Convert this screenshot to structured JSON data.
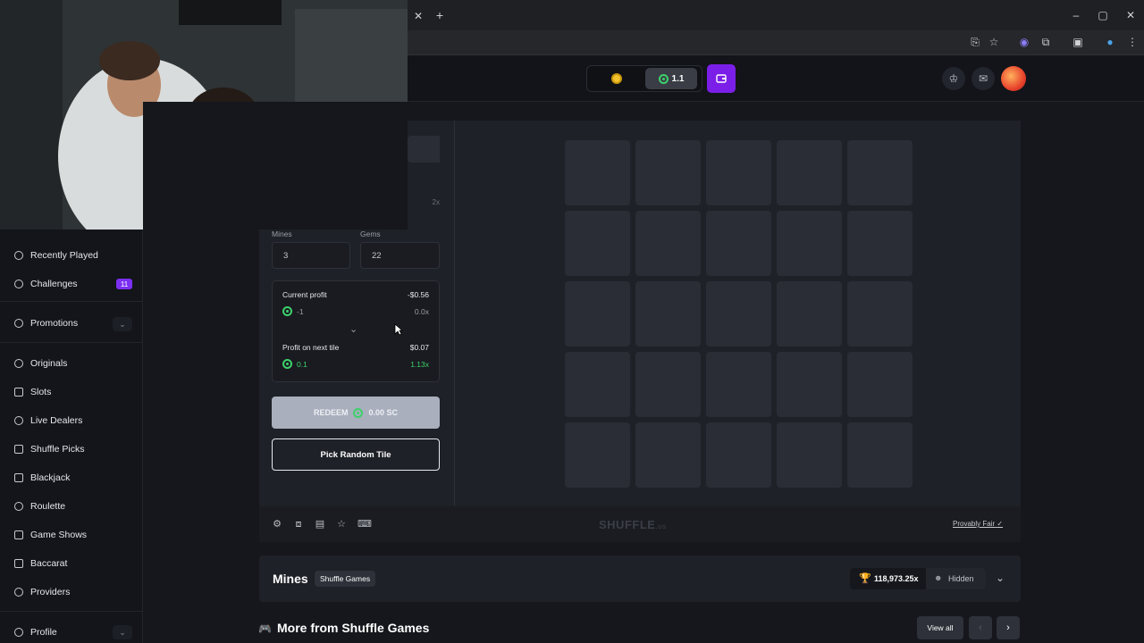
{
  "header": {
    "sc_balance": "1.1",
    "icons": [
      "gold-coin-icon",
      "sweeps-coin-icon",
      "wallet-icon",
      "crown-icon",
      "chat-icon",
      "avatar"
    ]
  },
  "sidebar": {
    "items": [
      {
        "label": "Recently Played",
        "icon": "clock-icon"
      },
      {
        "label": "Challenges",
        "icon": "target-icon",
        "badge": "11"
      },
      {
        "label": "Promotions",
        "icon": "gear-badge-icon"
      },
      {
        "label": "Originals",
        "icon": "originals-icon"
      },
      {
        "label": "Slots",
        "icon": "slots-icon"
      },
      {
        "label": "Live Dealers",
        "icon": "live-icon"
      },
      {
        "label": "Shuffle Picks",
        "icon": "picks-icon"
      },
      {
        "label": "Blackjack",
        "icon": "cards-icon"
      },
      {
        "label": "Roulette",
        "icon": "roulette-icon"
      },
      {
        "label": "Game Shows",
        "icon": "tv-icon"
      },
      {
        "label": "Baccarat",
        "icon": "baccarat-icon"
      },
      {
        "label": "Providers",
        "icon": "providers-icon"
      },
      {
        "label": "Profile",
        "icon": "profile-icon"
      }
    ]
  },
  "controls": {
    "multiplier_2x": "2x",
    "mines_label": "Mines",
    "mines_value": "3",
    "gems_label": "Gems",
    "gems_value": "22",
    "current_profit_label": "Current profit",
    "current_profit_usd": "-$0.56",
    "current_profit_sc": "-1",
    "current_profit_mult": "0.0x",
    "next_tile_label": "Profit on next tile",
    "next_tile_usd": "$0.07",
    "next_tile_sc": "0.1",
    "next_tile_mult": "1.13x",
    "redeem_label": "REDEEM",
    "redeem_amount": "0.00 SC",
    "pick_random_label": "Pick Random Tile"
  },
  "footer": {
    "logo": "SHUFFLE",
    "logo_suffix": ".us",
    "provably_fair": "Provably Fair"
  },
  "info": {
    "game_title": "Mines",
    "provider_tag": "Shuffle Games",
    "max_multiplier": "118,973.25x",
    "hidden_label": "Hidden",
    "more_title": "More from Shuffle Games",
    "view_all": "View all"
  },
  "colors": {
    "accent": "#7b1fe8",
    "green": "#3dd16b",
    "tile": "#2a2d35"
  }
}
